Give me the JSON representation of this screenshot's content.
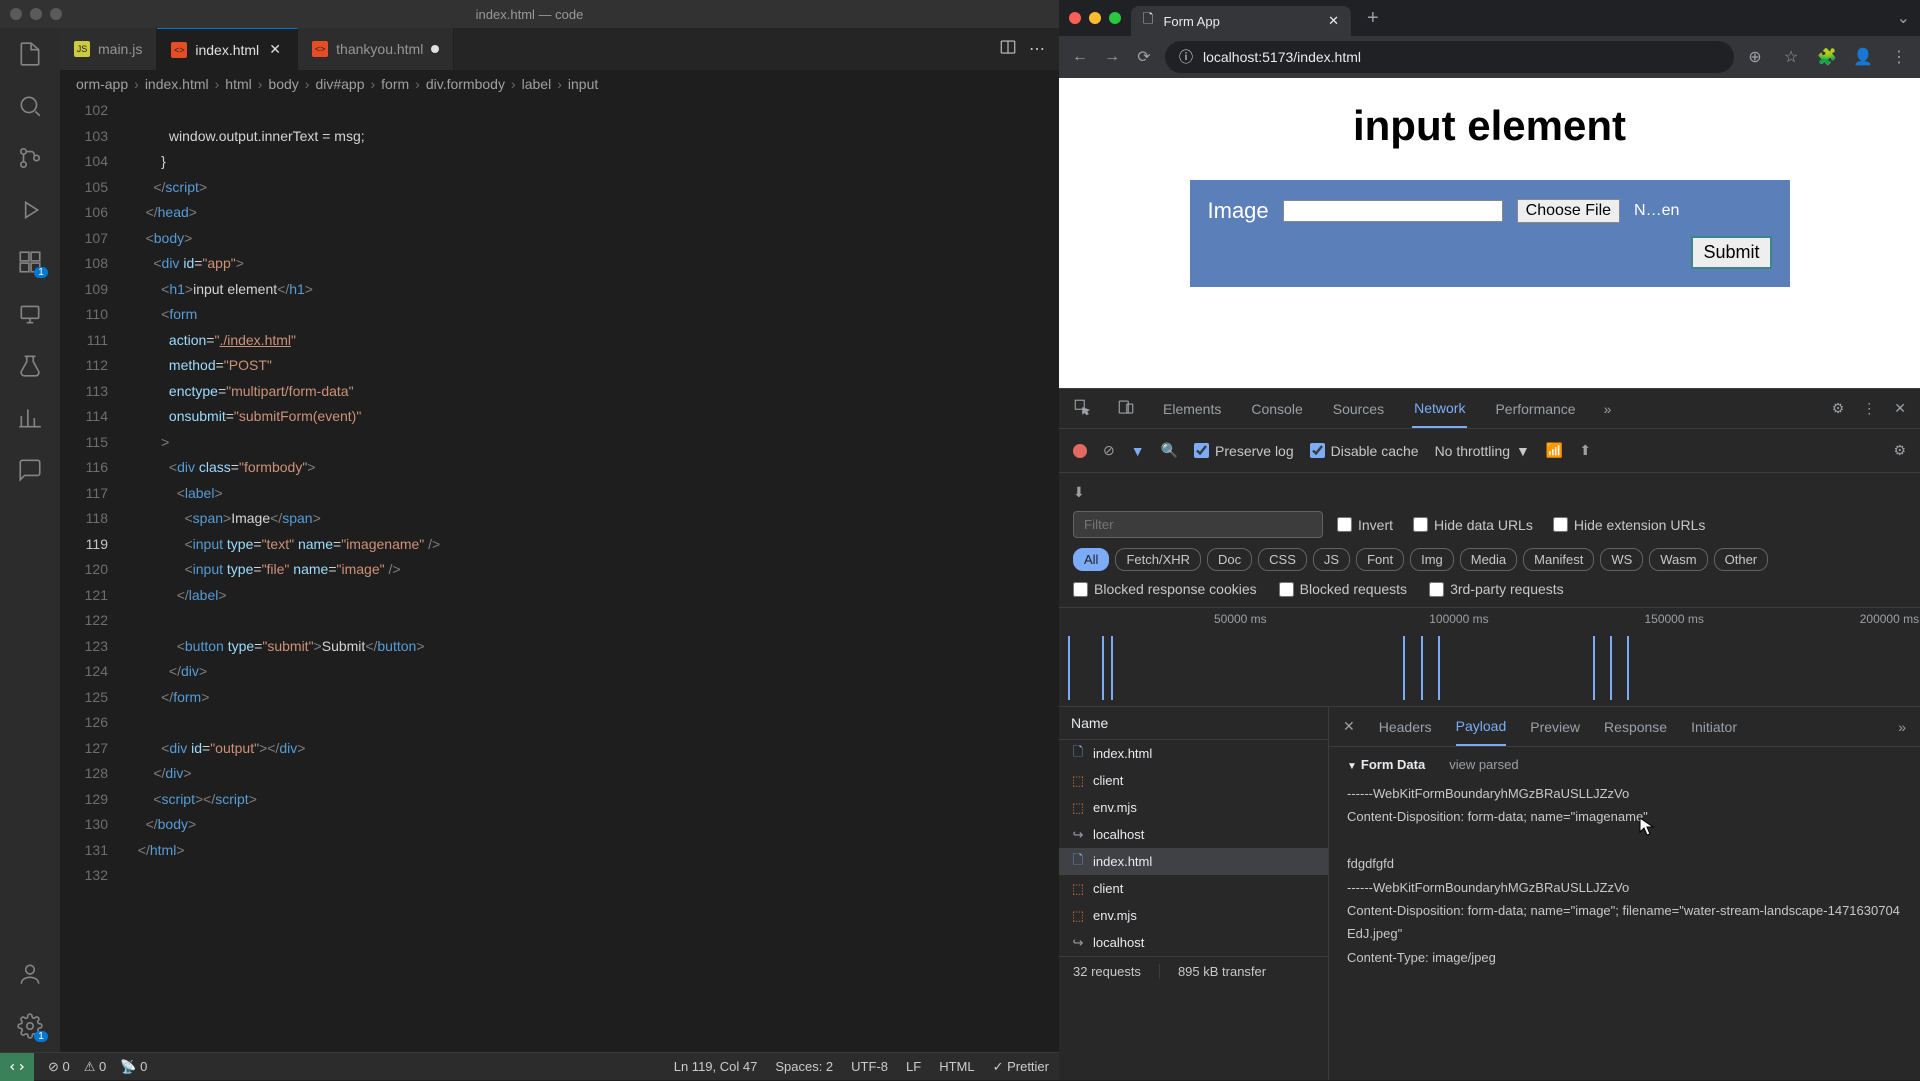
{
  "vscode": {
    "title": "index.html — code",
    "tabs": [
      {
        "label": "main.js",
        "icon": "js",
        "active": false,
        "close": false
      },
      {
        "label": "index.html",
        "icon": "html",
        "active": true,
        "close": true,
        "modified": true
      },
      {
        "label": "thankyou.html",
        "icon": "html",
        "active": false,
        "close": false,
        "modified": true
      }
    ],
    "breadcrumb": [
      "orm-app",
      "index.html",
      "html",
      "body",
      "div#app",
      "form",
      "div.formbody",
      "label",
      "input"
    ],
    "lines": [
      {
        "n": 102,
        "html": ""
      },
      {
        "n": 103,
        "html": "          window.output.innerText = msg;"
      },
      {
        "n": 104,
        "html": "        }"
      },
      {
        "n": 105,
        "html": "      <span class='tk-pun'>&lt;/</span><span class='tk-tag'>script</span><span class='tk-pun'>&gt;</span>"
      },
      {
        "n": 106,
        "html": "    <span class='tk-pun'>&lt;/</span><span class='tk-tag'>head</span><span class='tk-pun'>&gt;</span>"
      },
      {
        "n": 107,
        "html": "    <span class='tk-pun'>&lt;</span><span class='tk-tag'>body</span><span class='tk-pun'>&gt;</span>"
      },
      {
        "n": 108,
        "html": "      <span class='tk-pun'>&lt;</span><span class='tk-tag'>div</span> <span class='tk-attr'>id</span>=<span class='tk-str'>\"app\"</span><span class='tk-pun'>&gt;</span>"
      },
      {
        "n": 109,
        "html": "        <span class='tk-pun'>&lt;</span><span class='tk-tag'>h1</span><span class='tk-pun'>&gt;</span>input element<span class='tk-pun'>&lt;/</span><span class='tk-tag'>h1</span><span class='tk-pun'>&gt;</span>"
      },
      {
        "n": 110,
        "html": "        <span class='tk-pun'>&lt;</span><span class='tk-tag'>form</span>"
      },
      {
        "n": 111,
        "html": "          <span class='tk-attr'>action</span>=<span class='tk-str'>\"<u>./index.html</u>\"</span>"
      },
      {
        "n": 112,
        "html": "          <span class='tk-attr'>method</span>=<span class='tk-str'>\"POST\"</span>"
      },
      {
        "n": 113,
        "html": "          <span class='tk-attr'>enctype</span>=<span class='tk-str'>\"multipart/form-data\"</span>"
      },
      {
        "n": 114,
        "html": "          <span class='tk-attr'>onsubmit</span>=<span class='tk-str'>\"submitForm(event)\"</span>"
      },
      {
        "n": 115,
        "html": "        <span class='tk-pun'>&gt;</span>"
      },
      {
        "n": 116,
        "html": "          <span class='tk-pun'>&lt;</span><span class='tk-tag'>div</span> <span class='tk-attr'>class</span>=<span class='tk-str'>\"formbody\"</span><span class='tk-pun'>&gt;</span>"
      },
      {
        "n": 117,
        "html": "            <span class='tk-pun'>&lt;</span><span class='tk-tag'>label</span><span class='tk-pun'>&gt;</span>"
      },
      {
        "n": 118,
        "html": "              <span class='tk-pun'>&lt;</span><span class='tk-tag'>span</span><span class='tk-pun'>&gt;</span>Image<span class='tk-pun'>&lt;/</span><span class='tk-tag'>span</span><span class='tk-pun'>&gt;</span>"
      },
      {
        "n": 119,
        "html": "              <span class='tk-pun'>&lt;</span><span class='tk-tag'>input</span> <span class='tk-attr'>type</span>=<span class='tk-str'>\"text\"</span> <span class='tk-attr'>name</span>=<span class='tk-str'>\"imagename\"</span> <span class='tk-pun'>/&gt;</span>",
        "current": true
      },
      {
        "n": 120,
        "html": "              <span class='tk-pun'>&lt;</span><span class='tk-tag'>input</span> <span class='tk-attr'>type</span>=<span class='tk-str'>\"file\"</span> <span class='tk-attr'>name</span>=<span class='tk-str'>\"image\"</span> <span class='tk-pun'>/&gt;</span>"
      },
      {
        "n": 121,
        "html": "            <span class='tk-pun'>&lt;/</span><span class='tk-tag'>label</span><span class='tk-pun'>&gt;</span>"
      },
      {
        "n": 122,
        "html": ""
      },
      {
        "n": 123,
        "html": "            <span class='tk-pun'>&lt;</span><span class='tk-tag'>button</span> <span class='tk-attr'>type</span>=<span class='tk-str'>\"submit\"</span><span class='tk-pun'>&gt;</span>Submit<span class='tk-pun'>&lt;/</span><span class='tk-tag'>button</span><span class='tk-pun'>&gt;</span>"
      },
      {
        "n": 124,
        "html": "          <span class='tk-pun'>&lt;/</span><span class='tk-tag'>div</span><span class='tk-pun'>&gt;</span>"
      },
      {
        "n": 125,
        "html": "        <span class='tk-pun'>&lt;/</span><span class='tk-tag'>form</span><span class='tk-pun'>&gt;</span>"
      },
      {
        "n": 126,
        "html": ""
      },
      {
        "n": 127,
        "html": "        <span class='tk-pun'>&lt;</span><span class='tk-tag'>div</span> <span class='tk-attr'>id</span>=<span class='tk-str'>\"output\"</span><span class='tk-pun'>&gt;&lt;/</span><span class='tk-tag'>div</span><span class='tk-pun'>&gt;</span>"
      },
      {
        "n": 128,
        "html": "      <span class='tk-pun'>&lt;/</span><span class='tk-tag'>div</span><span class='tk-pun'>&gt;</span>"
      },
      {
        "n": 129,
        "html": "      <span class='tk-pun'>&lt;</span><span class='tk-tag'>script</span><span class='tk-pun'>&gt;&lt;/</span><span class='tk-tag'>script</span><span class='tk-pun'>&gt;</span>"
      },
      {
        "n": 130,
        "html": "    <span class='tk-pun'>&lt;/</span><span class='tk-tag'>body</span><span class='tk-pun'>&gt;</span>"
      },
      {
        "n": 131,
        "html": "  <span class='tk-pun'>&lt;/</span><span class='tk-tag'>html</span><span class='tk-pun'>&gt;</span>"
      },
      {
        "n": 132,
        "html": ""
      }
    ],
    "status": {
      "errors": "0",
      "warnings": "0",
      "ports": "0",
      "cursor": "Ln 119, Col 47",
      "spaces": "Spaces: 2",
      "encoding": "UTF-8",
      "eol": "LF",
      "lang": "HTML",
      "prettier": "Prettier"
    },
    "activity_badges": {
      "extensions": "1",
      "settings": "1"
    }
  },
  "browser": {
    "tab_title": "Form App",
    "url": "localhost:5173/index.html",
    "page": {
      "heading": "input element",
      "label": "Image",
      "file_button": "Choose File",
      "file_status": "N…en",
      "submit": "Submit"
    }
  },
  "devtools": {
    "tabs": [
      "Elements",
      "Console",
      "Sources",
      "Network",
      "Performance"
    ],
    "active_tab": "Network",
    "controls": {
      "preserve_log": "Preserve log",
      "disable_cache": "Disable cache",
      "throttling": "No throttling"
    },
    "filter_placeholder": "Filter",
    "filter_checks": [
      "Invert",
      "Hide data URLs",
      "Hide extension URLs"
    ],
    "pills": [
      "All",
      "Fetch/XHR",
      "Doc",
      "CSS",
      "JS",
      "Font",
      "Img",
      "Media",
      "Manifest",
      "WS",
      "Wasm",
      "Other"
    ],
    "active_pill": "All",
    "block_checks": [
      "Blocked response cookies",
      "Blocked requests",
      "3rd-party requests"
    ],
    "waterfall_labels": [
      "50000 ms",
      "100000 ms",
      "150000 ms",
      "200000 ms"
    ],
    "reqlist_header": "Name",
    "requests": [
      {
        "name": "index.html",
        "icon": "doc"
      },
      {
        "name": "client",
        "icon": "ws"
      },
      {
        "name": "env.mjs",
        "icon": "js"
      },
      {
        "name": "localhost",
        "icon": "redirect"
      },
      {
        "name": "index.html",
        "icon": "doc",
        "selected": true
      },
      {
        "name": "client",
        "icon": "ws"
      },
      {
        "name": "env.mjs",
        "icon": "js"
      },
      {
        "name": "localhost",
        "icon": "redirect"
      }
    ],
    "subtabs": [
      "Headers",
      "Payload",
      "Preview",
      "Response",
      "Initiator"
    ],
    "active_subtab": "Payload",
    "formdata_title": "Form Data",
    "view_parsed": "view parsed",
    "formdata_body": "------WebKitFormBoundaryhMGzBRaUSLLJZzVo\nContent-Disposition: form-data; name=\"imagename\"\n\nfdgdfgfd\n------WebKitFormBoundaryhMGzBRaUSLLJZzVo\nContent-Disposition: form-data; name=\"image\"; filename=\"water-stream-landscape-1471630704EdJ.jpeg\"\nContent-Type: image/jpeg",
    "status_bar": {
      "requests": "32 requests",
      "transfer": "895 kB transfer"
    }
  }
}
